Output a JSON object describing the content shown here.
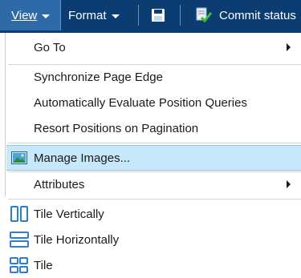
{
  "toolbar": {
    "view_label": "View",
    "format_label": "Format",
    "save_icon": "save-icon",
    "commit_icon": "commit-status-icon",
    "commit_label": "Commit status"
  },
  "menu": {
    "go_to": "Go To",
    "synchronize_page_edge": "Synchronize Page Edge",
    "auto_evaluate": "Automatically Evaluate Position Queries",
    "resort_positions": "Resort Positions on Pagination",
    "manage_images": "Manage Images...",
    "attributes": "Attributes",
    "tile_vertically": "Tile Vertically",
    "tile_horizontally": "Tile Horizontally",
    "tile": "Tile"
  },
  "colors": {
    "toolbar_bg": "#0b3d73",
    "active_menu_bg": "#2e6aa8",
    "hover_bg": "#c7e7fb",
    "icon_blue": "#2a7fd4"
  }
}
